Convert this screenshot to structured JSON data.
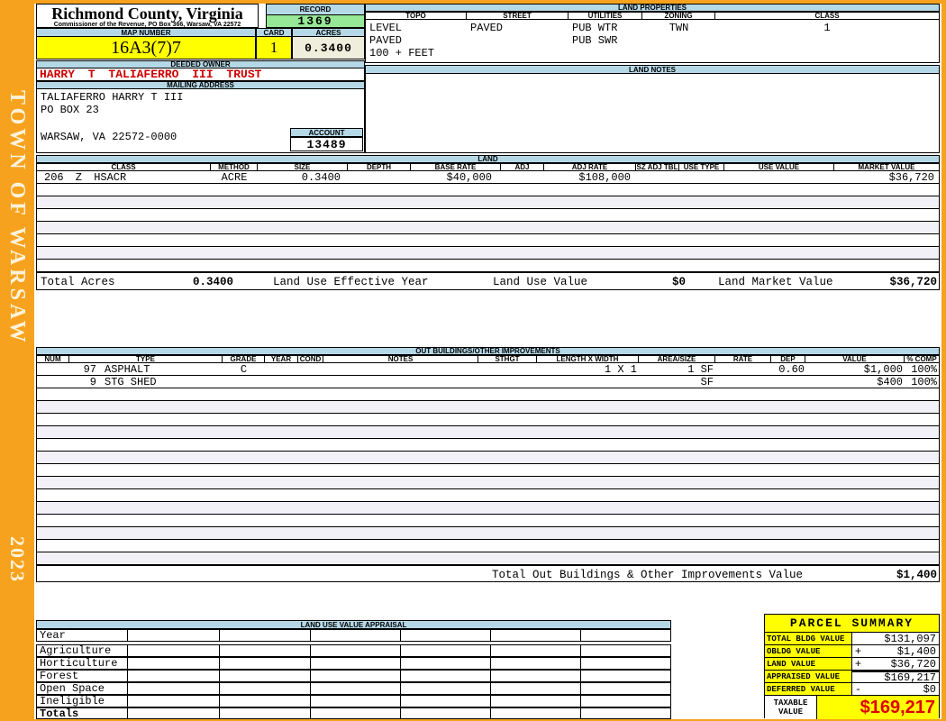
{
  "colors": {
    "frame_orange": "#F6A21E",
    "band_blue": "#B5D8E6",
    "record_green": "#96E796",
    "highlight_yellow": "#FFFF00",
    "acres_cream": "#EFEDDC",
    "owner_red": "#CC0000",
    "taxable_red": "#DD0000"
  },
  "sidebar": {
    "title": "TOWN OF WARSAW",
    "year": "2023"
  },
  "header": {
    "county_title": "Richmond County, Virginia",
    "county_subtitle": "Commissioner of the Revenue, PO Box 366, Warsaw, VA 22572",
    "record_label": "RECORD",
    "record_value": "1369",
    "map_number_label": "MAP NUMBER",
    "map_number_value": "16A3(7)7",
    "card_label": "CARD",
    "card_value": "1",
    "acres_label": "ACRES",
    "acres_value": "0.3400"
  },
  "owner": {
    "deeded_owner_label": "DEEDED OWNER",
    "deeded_owner_value": "HARRY T TALIAFERRO III TRUST",
    "mailing_address_label": "MAILING ADDRESS",
    "address_line1": "TALIAFERRO HARRY T III",
    "address_line2": "PO BOX 23",
    "address_line3": "WARSAW, VA 22572-0000",
    "account_label": "ACCOUNT",
    "account_value": "13489"
  },
  "land_properties": {
    "title": "LAND PROPERTIES",
    "columns": [
      "TOPO",
      "STREET",
      "UTILITIES",
      "ZONING",
      "CLASS"
    ],
    "rows": [
      {
        "topo": "LEVEL",
        "street": "PAVED",
        "utilities": "PUB WTR",
        "zoning": "TWN",
        "class": "1"
      },
      {
        "topo": "PAVED",
        "street": "",
        "utilities": "PUB SWR",
        "zoning": "",
        "class": ""
      },
      {
        "topo": "100 + FEET",
        "street": "",
        "utilities": "",
        "zoning": "",
        "class": ""
      }
    ]
  },
  "land_notes": {
    "title": "LAND NOTES"
  },
  "land": {
    "title": "LAND",
    "columns": [
      "CLASS",
      "METHOD",
      "SIZE",
      "DEPTH",
      "BASE RATE",
      "ADJ",
      "ADJ RATE",
      "SZ ADJ TBL",
      "USE TYPE",
      "USE VALUE",
      "MARKET VALUE"
    ],
    "row": {
      "class": "206 Z HSACR",
      "method": "ACRE",
      "size": "0.3400",
      "depth": "",
      "base_rate": "$40,000",
      "adj": "",
      "adj_rate": "$108,000",
      "sz_adj_tbl": "",
      "use_type": "",
      "use_value": "",
      "market_value": "$36,720"
    },
    "total_acres_label": "Total Acres",
    "total_acres_value": "0.3400",
    "effective_year_label": "Land Use Effective Year",
    "use_value_label": "Land Use Value",
    "use_value_value": "$0",
    "market_value_label": "Land Market Value",
    "market_value_value": "$36,720"
  },
  "out_buildings": {
    "title": "OUT BUILDINGS/OTHER IMPROVEMENTS",
    "columns": [
      "NUM",
      "TYPE",
      "GRADE",
      "YEAR",
      "COND",
      "NOTES",
      "STHGT",
      "LENGTH X WIDTH",
      "AREA/SIZE",
      "RATE",
      "DEP",
      "VALUE",
      "% COMP"
    ],
    "rows": [
      {
        "num": "97",
        "type": "ASPHALT",
        "grade": "C",
        "year": "",
        "cond": "",
        "notes": "",
        "sthgt": "",
        "length_width": "1 X 1",
        "area_size": "1 SF",
        "rate": "",
        "dep": "0.60",
        "value": "$1,000",
        "pct_comp": "100%"
      },
      {
        "num": "9",
        "type": "STG SHED",
        "grade": "",
        "year": "",
        "cond": "",
        "notes": "",
        "sthgt": "",
        "length_width": "",
        "area_size": "SF",
        "rate": "",
        "dep": "",
        "value": "$400",
        "pct_comp": "100%"
      }
    ],
    "total_label": "Total Out Buildings & Other Improvements Value",
    "total_value": "$1,400"
  },
  "land_use_appraisal": {
    "title": "LAND USE VALUE APPRAISAL",
    "row_labels": [
      "Year",
      "Agriculture",
      "Horticulture",
      "Forest",
      "Open Space",
      "Ineligible",
      "Totals"
    ]
  },
  "parcel_summary": {
    "title": "PARCEL SUMMARY",
    "rows": [
      {
        "label": "TOTAL BLDG VALUE",
        "op": "",
        "value": "$131,097"
      },
      {
        "label": "OBLDG VALUE",
        "op": "+",
        "value": "$1,400"
      },
      {
        "label": "LAND VALUE",
        "op": "+",
        "value": "$36,720"
      },
      {
        "label": "APPRAISED VALUE",
        "op": "",
        "value": "$169,217"
      },
      {
        "label": "DEFERRED VALUE",
        "op": "-",
        "value": "$0"
      }
    ],
    "taxable_label": "TAXABLE VALUE",
    "taxable_value": "$169,217"
  }
}
